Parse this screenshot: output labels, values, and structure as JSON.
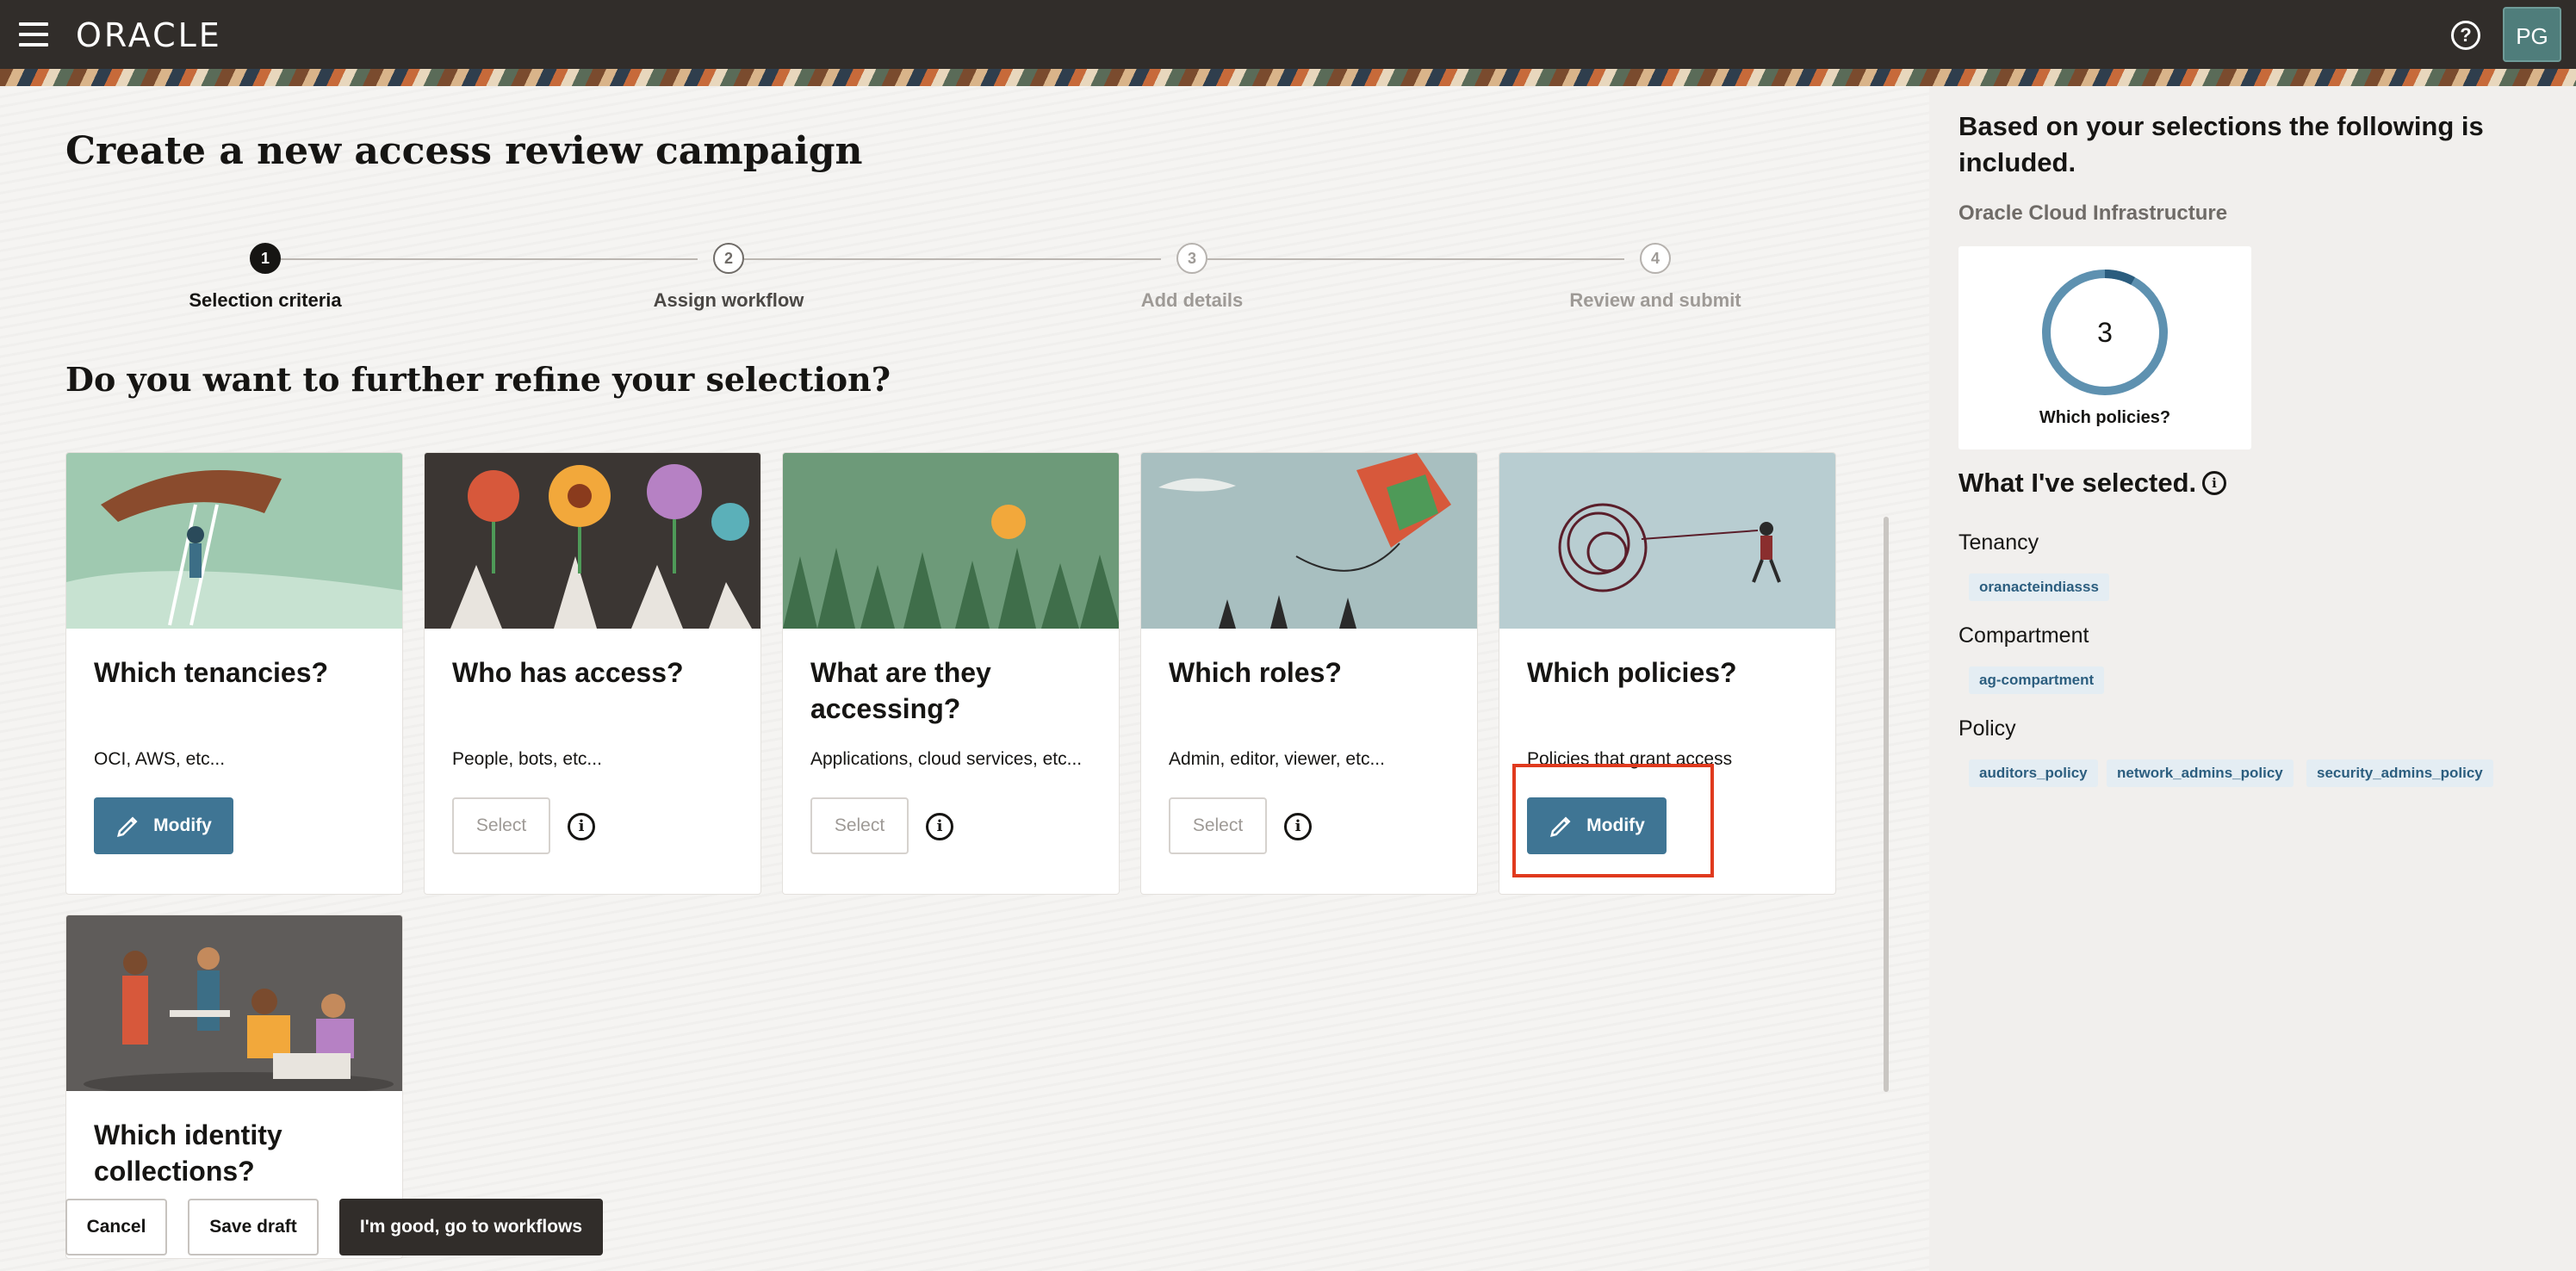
{
  "header": {
    "logo_text": "ORACLE",
    "avatar_initials": "PG",
    "help_glyph": "?"
  },
  "page": {
    "title": "Create a new access review campaign",
    "section_title": "Do you want to further refine your selection?"
  },
  "stepper": {
    "steps": [
      {
        "number": "1",
        "label": "Selection criteria",
        "state": "active"
      },
      {
        "number": "2",
        "label": "Assign workflow",
        "state": "pending"
      },
      {
        "number": "3",
        "label": "Add details",
        "state": "future"
      },
      {
        "number": "4",
        "label": "Review and submit",
        "state": "future"
      }
    ]
  },
  "cards": [
    {
      "title": "Which tenancies?",
      "description": "OCI, AWS, etc...",
      "button": "Modify",
      "button_type": "modify"
    },
    {
      "title": "Who has access?",
      "description": "People, bots, etc...",
      "button": "Select",
      "button_type": "select"
    },
    {
      "title": "What are they accessing?",
      "description": "Applications, cloud services, etc...",
      "button": "Select",
      "button_type": "select"
    },
    {
      "title": "Which roles?",
      "description": "Admin, editor, viewer, etc...",
      "button": "Select",
      "button_type": "select"
    },
    {
      "title": "Which policies?",
      "description": "Policies that grant access",
      "button": "Modify",
      "button_type": "modify"
    },
    {
      "title": "Which identity collections?",
      "description": "",
      "button": "",
      "button_type": "none"
    }
  ],
  "footer": {
    "cancel": "Cancel",
    "save_draft": "Save draft",
    "continue": "I'm good, go to workflows"
  },
  "panel": {
    "heading": "Based on your selections the following is included.",
    "subheading": "Oracle Cloud Infrastructure",
    "donut_value": "3",
    "donut_label": "Which policies?",
    "selected_heading": "What I've selected.",
    "groups": [
      {
        "label": "Tenancy",
        "chips": [
          "oranacteindiasss"
        ]
      },
      {
        "label": "Compartment",
        "chips": [
          "ag-compartment"
        ]
      },
      {
        "label": "Policy",
        "chips": [
          "auditors_policy",
          "network_admins_policy",
          "security_admins_policy"
        ]
      }
    ]
  },
  "colors": {
    "header_bg": "#312d2a",
    "modify_button": "#3f7594",
    "highlight_border": "#e03a1e",
    "chip_bg": "#e4edf3",
    "chip_text": "#2c5e7f",
    "donut_track": "#5e91b0",
    "donut_accent": "#2b5d7e"
  }
}
